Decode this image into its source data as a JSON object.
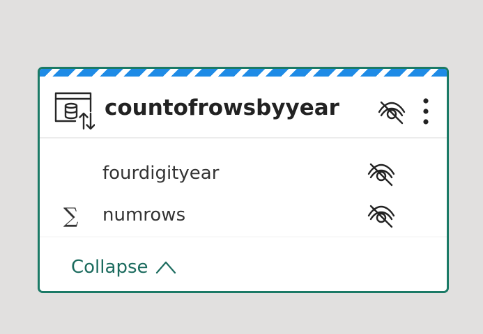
{
  "table": {
    "name": "countofrowsbyyear",
    "icon": "table-dataset-sync-icon",
    "header_visibility_icon": "eye-hidden-icon",
    "menu_icon": "more-vertical-icon"
  },
  "columns": [
    {
      "name": "fourdigityear",
      "type_icon": "",
      "visibility_icon": "eye-hidden-icon"
    },
    {
      "name": "numrows",
      "type_icon": "∑",
      "visibility_icon": "eye-hidden-icon"
    }
  ],
  "footer": {
    "collapse_label": "Collapse",
    "collapse_icon": "chevron-up-icon"
  },
  "colors": {
    "border": "#1b7a66",
    "stripe": "#1e8be6",
    "link": "#1b6b5e",
    "background": "#e1e0df"
  }
}
